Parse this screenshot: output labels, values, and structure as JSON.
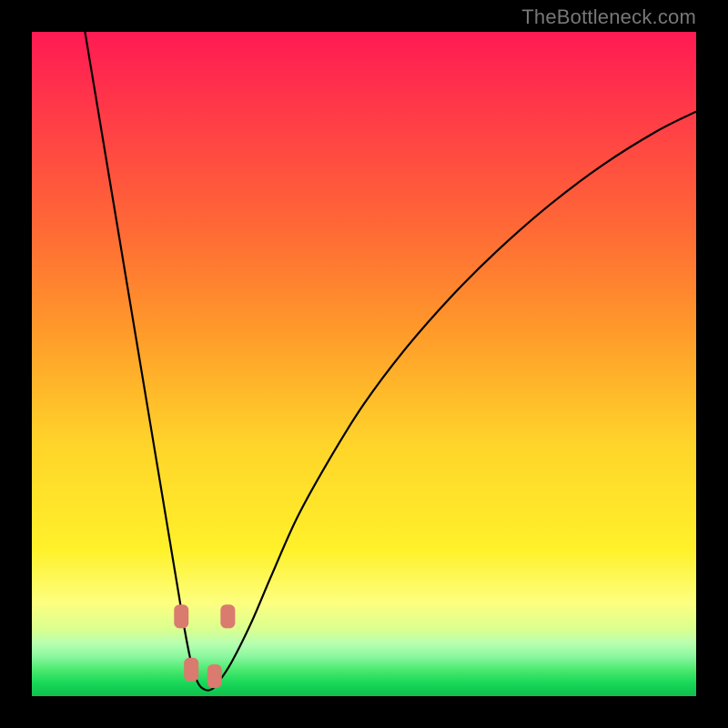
{
  "watermark": "TheBottleneck.com",
  "chart_data": {
    "type": "line",
    "title": "",
    "xlabel": "",
    "ylabel": "",
    "xlim": [
      0,
      100
    ],
    "ylim": [
      0,
      100
    ],
    "series": [
      {
        "name": "bottleneck-curve",
        "x": [
          8,
          10,
          12,
          14,
          16,
          18,
          20,
          22,
          23,
          24,
          25,
          26,
          27,
          28,
          30,
          33,
          36,
          40,
          45,
          50,
          56,
          63,
          70,
          78,
          86,
          94,
          100
        ],
        "y": [
          100,
          88,
          76,
          64,
          52,
          40,
          28,
          16,
          10,
          5,
          2,
          1,
          1,
          2,
          5,
          11,
          18,
          27,
          36,
          44,
          52,
          60,
          67,
          74,
          80,
          85,
          88
        ]
      }
    ],
    "markers": [
      {
        "name": "left-upper",
        "x": 22.5,
        "y": 12
      },
      {
        "name": "left-lower",
        "x": 24.0,
        "y": 4
      },
      {
        "name": "right-lower",
        "x": 27.5,
        "y": 3
      },
      {
        "name": "right-upper",
        "x": 29.5,
        "y": 12
      }
    ],
    "marker_style": {
      "fill": "#d97b6f",
      "rx": 6,
      "w": 16,
      "h": 26
    },
    "curve_stroke": "#000000",
    "curve_width": 2.2
  }
}
